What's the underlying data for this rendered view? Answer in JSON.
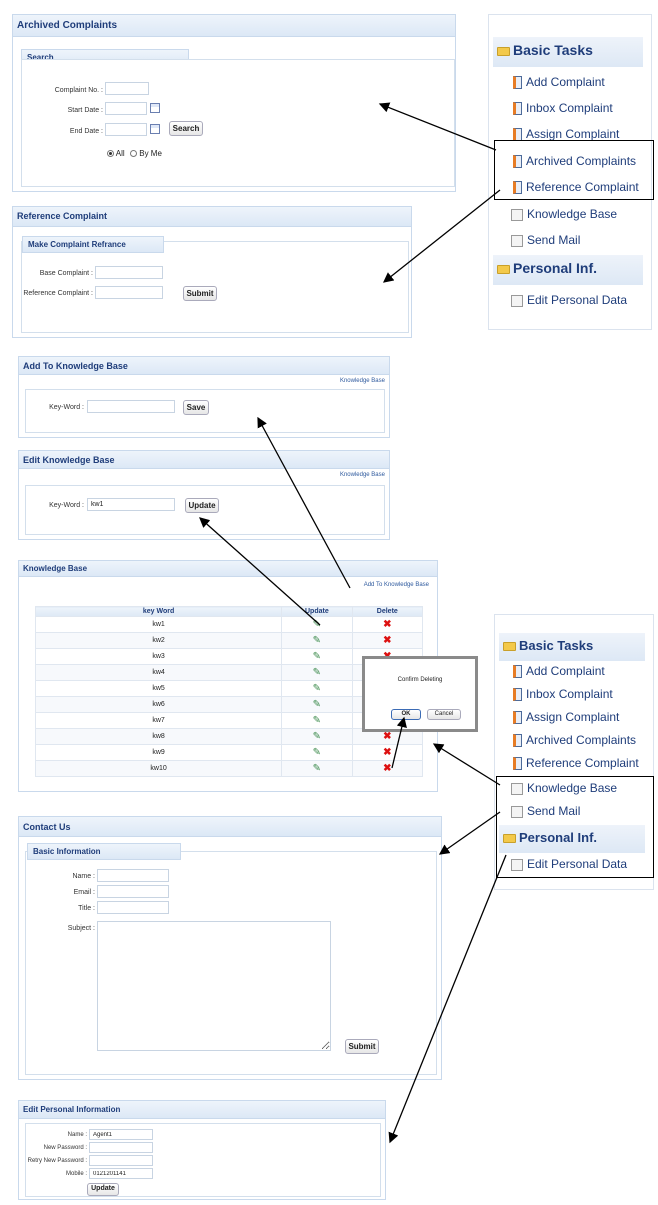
{
  "archived": {
    "title": "Archived Complaints",
    "search_header": "Search",
    "complaint_no_label": "Complaint No. :",
    "start_date_label": "Start Date :",
    "end_date_label": "End Date :",
    "search_button": "Search",
    "radio_all": "All",
    "radio_by_me": "By Me"
  },
  "reference": {
    "title": "Reference Complaint",
    "subheader": "Make Complaint Refrance",
    "base_label": "Base Complaint :",
    "ref_label": "Reference Complaint :",
    "submit_button": "Submit"
  },
  "add_kb": {
    "title": "Add To Knowledge Base",
    "link": "Knowledge Base",
    "keyword_label": "Key-Word :",
    "save_button": "Save"
  },
  "edit_kb": {
    "title": "Edit Knowledge Base",
    "link": "Knowledge Base",
    "keyword_label": "Key-Word :",
    "keyword_value": "kw1",
    "update_button": "Update"
  },
  "kb_list": {
    "title": "Knowledge Base",
    "add_link": "Add To Knowledge Base",
    "columns": [
      "key Word",
      "Update",
      "Delete"
    ],
    "rows": [
      "kw1",
      "kw2",
      "kw3",
      "kw4",
      "kw5",
      "kw6",
      "kw7",
      "kw8",
      "kw9",
      "kw10"
    ]
  },
  "confirm": {
    "message": "Confirm Deleting",
    "ok": "OK",
    "cancel": "Cancel"
  },
  "contact": {
    "title": "Contact Us",
    "subheader": "Basic Information",
    "name_label": "Name :",
    "email_label": "Email :",
    "title_label": "Title :",
    "subject_label": "Subject :",
    "submit_button": "Submit"
  },
  "personal": {
    "title": "Edit Personal Information",
    "name_label": "Name :",
    "name_value": "Agent1",
    "new_password_label": "New Password :",
    "retry_password_label": "Retry New Password :",
    "mobile_label": "Mobile :",
    "mobile_value": "0121201141",
    "update_button": "Update"
  },
  "sidebar": {
    "basic_tasks": "Basic Tasks",
    "items": [
      "Add Complaint",
      "Inbox Complaint",
      "Assign Complaint",
      "Archived Complaints",
      "Reference Complaint",
      "Knowledge Base",
      "Send Mail"
    ],
    "personal": "Personal Inf.",
    "personal_items": [
      "Edit Personal Data"
    ]
  }
}
